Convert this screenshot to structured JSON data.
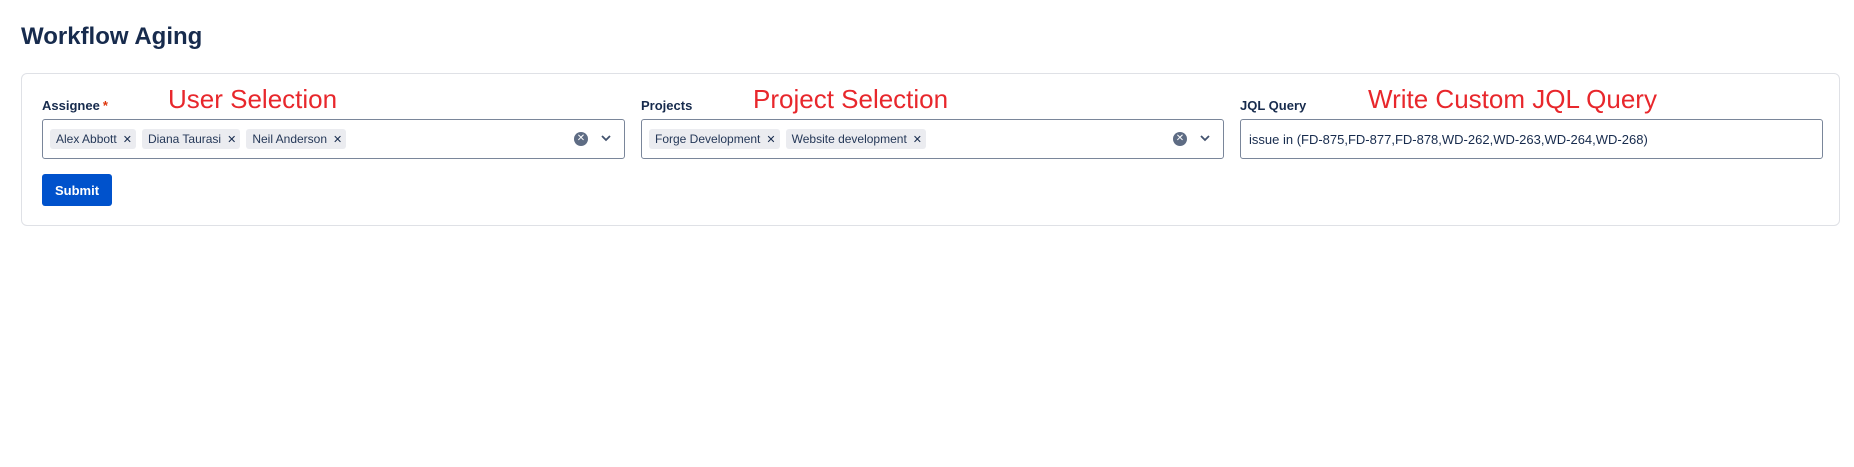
{
  "page": {
    "title": "Workflow Aging"
  },
  "assignee": {
    "label": "Assignee",
    "required_mark": "*",
    "annotation": "User Selection",
    "tags": [
      "Alex Abbott",
      "Diana Taurasi",
      "Neil Anderson"
    ]
  },
  "projects": {
    "label": "Projects",
    "annotation": "Project Selection",
    "tags": [
      "Forge Development",
      "Website development"
    ]
  },
  "jql": {
    "label": "JQL Query",
    "annotation": "Write Custom JQL Query",
    "value": "issue in (FD-875,FD-877,FD-878,WD-262,WD-263,WD-264,WD-268)"
  },
  "submit": {
    "label": "Submit"
  },
  "colors": {
    "primary": "#0052cc",
    "annotation": "#e8272c",
    "required": "#de350b"
  },
  "icons": {
    "tag_remove": "close-icon",
    "clear": "clear-icon",
    "dropdown": "chevron-down-icon"
  }
}
